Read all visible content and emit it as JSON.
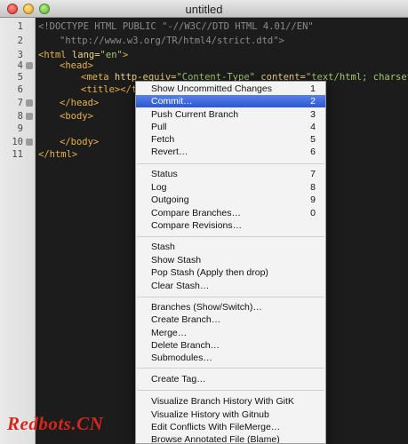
{
  "window": {
    "title": "untitled"
  },
  "gutter": {
    "line_numbers": [
      "1",
      "2",
      "3",
      "4",
      "5",
      "6",
      "7",
      "8",
      "9",
      "10",
      "11"
    ]
  },
  "code": {
    "l1_doctype": "<!DOCTYPE HTML PUBLIC \"-//W3C//DTD HTML 4.01//EN\"",
    "l2_url": "\"http://www.w3.org/TR/html4/strict.dtd\">",
    "l3_open": "<html",
    "l3_attr": " lang=",
    "l3_val": "\"en\"",
    "l3_close": ">",
    "l4": "<head>",
    "l5_open": "<meta",
    "l5_attr1": " http-equiv=",
    "l5_val1": "\"Content-Type\"",
    "l5_attr2": " content=",
    "l5_val2": "\"text/html; charset=u",
    "l6": "<title></t",
    "l7": "</head>",
    "l8": "<body>",
    "l10": "</body>",
    "l11": "</html>"
  },
  "menu": {
    "items": [
      {
        "label": "Show Uncommitted Changes",
        "key": "1"
      },
      {
        "label": "Commit…",
        "key": "2"
      },
      {
        "label": "Push Current Branch",
        "key": "3"
      },
      {
        "label": "Pull",
        "key": "4"
      },
      {
        "label": "Fetch",
        "key": "5"
      },
      {
        "label": "Revert…",
        "key": "6"
      },
      {
        "label": "Status",
        "key": "7"
      },
      {
        "label": "Log",
        "key": "8"
      },
      {
        "label": "Outgoing",
        "key": "9"
      },
      {
        "label": "Compare Branches…",
        "key": "0"
      },
      {
        "label": "Compare Revisions…",
        "key": ""
      },
      {
        "label": "Stash",
        "key": ""
      },
      {
        "label": "Show Stash",
        "key": ""
      },
      {
        "label": "Pop Stash (Apply then drop)",
        "key": ""
      },
      {
        "label": "Clear Stash…",
        "key": ""
      },
      {
        "label": "Branches (Show/Switch)…",
        "key": ""
      },
      {
        "label": "Create Branch…",
        "key": ""
      },
      {
        "label": "Merge…",
        "key": ""
      },
      {
        "label": "Delete Branch…",
        "key": ""
      },
      {
        "label": "Submodules…",
        "key": ""
      },
      {
        "label": "Create Tag…",
        "key": ""
      },
      {
        "label": "Visualize Branch History With GitK",
        "key": ""
      },
      {
        "label": "Visualize History with Gitnub",
        "key": ""
      },
      {
        "label": "Edit Conflicts With FileMerge…",
        "key": ""
      },
      {
        "label": "Browse Annotated File (Blame)",
        "key": ""
      }
    ],
    "selected": "Commit…"
  },
  "watermark": "Redbots.CN",
  "colors": {
    "menu_highlight": "#2b57d6",
    "editor_bg": "#1c1c1c",
    "tag": "#e5b34a",
    "string": "#a3c76a"
  }
}
